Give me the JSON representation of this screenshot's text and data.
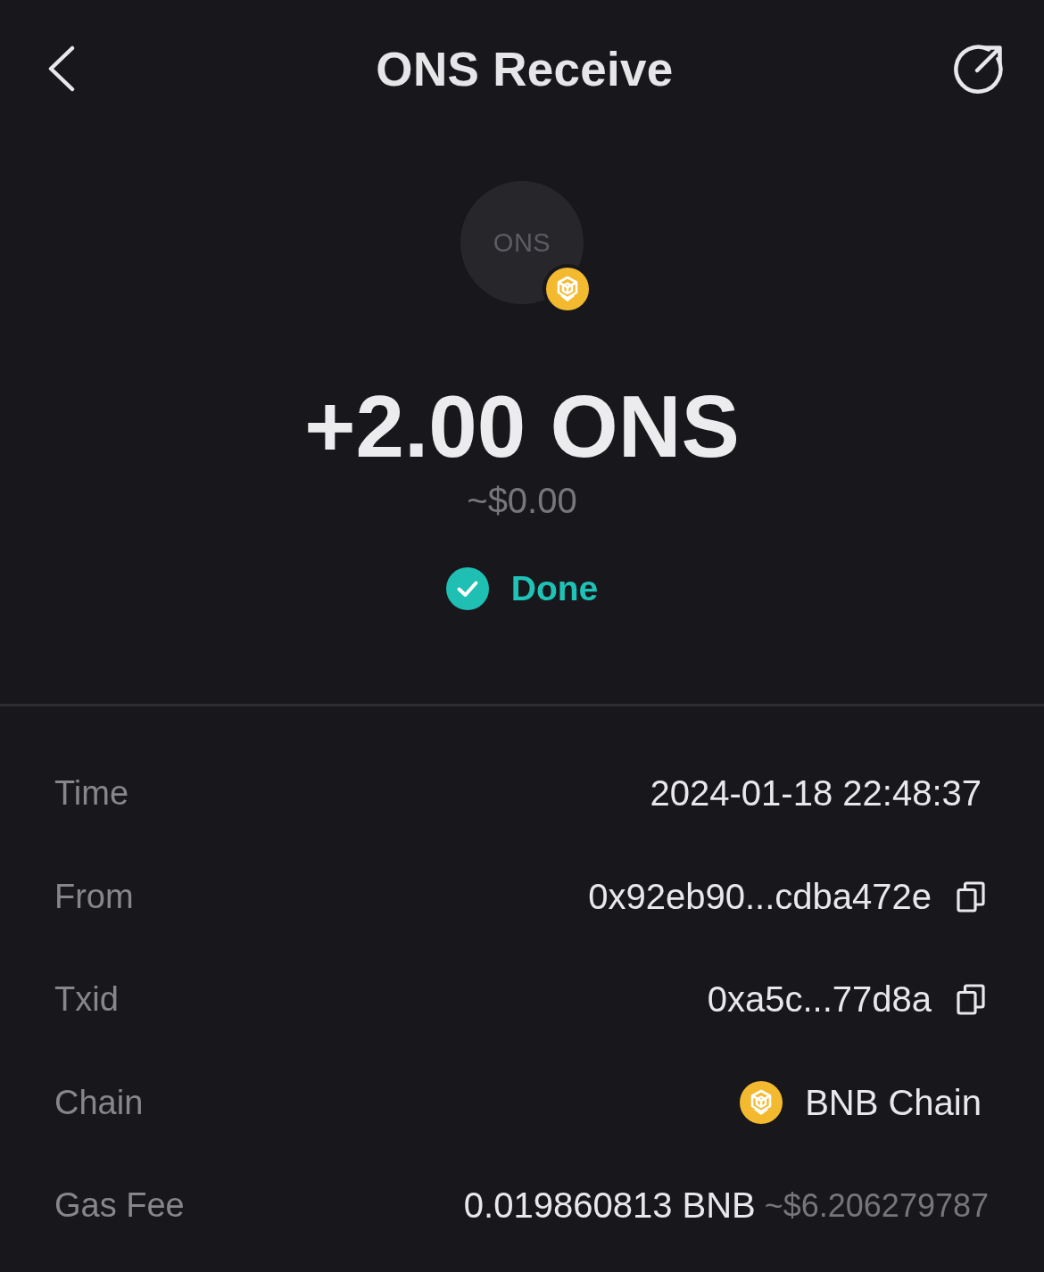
{
  "header": {
    "title": "ONS Receive"
  },
  "token": {
    "symbol": "ONS"
  },
  "amount": "+2.00 ONS",
  "fiat_value": "~$0.00",
  "status": {
    "kind": "done",
    "label": "Done"
  },
  "details": [
    {
      "kind": "text",
      "label": "Time",
      "value": "2024-01-18 22:48:37"
    },
    {
      "kind": "copy",
      "label": "From",
      "value": "0x92eb90...cdba472e"
    },
    {
      "kind": "copy",
      "label": "Txid",
      "value": "0xa5c...77d8a"
    },
    {
      "kind": "chain",
      "label": "Chain",
      "value": "BNB Chain"
    },
    {
      "kind": "fee",
      "label": "Gas Fee",
      "value": "0.019860813 BNB",
      "secondary": "~$6.206279787"
    }
  ]
}
